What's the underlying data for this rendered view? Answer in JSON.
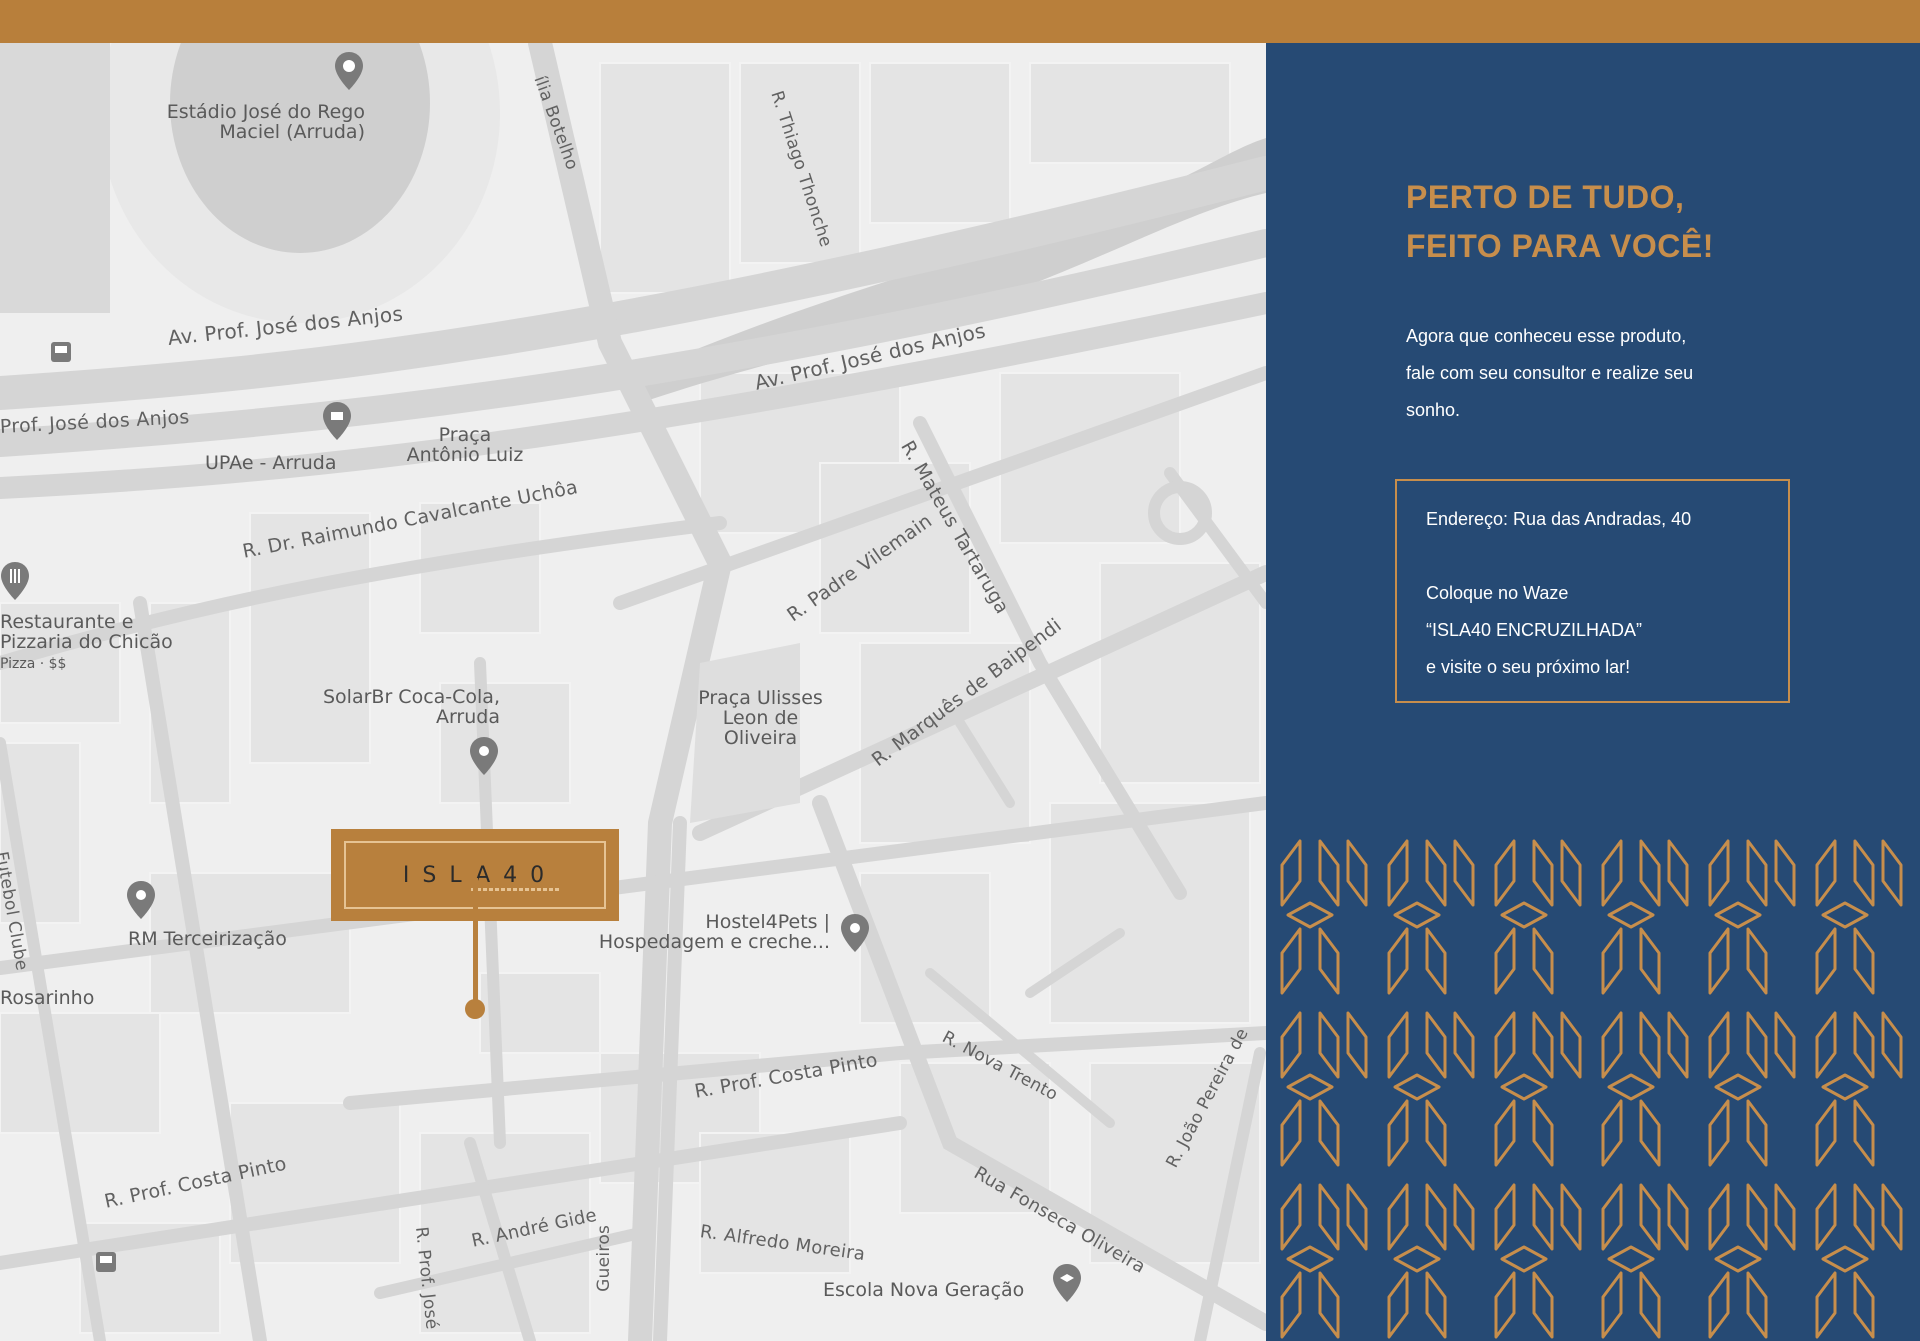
{
  "colors": {
    "accent": "#b87f3b",
    "panel": "#264a74",
    "map_bg": "#efefef",
    "road": "#d6d6d6",
    "block": "#e2e2e2",
    "gold_text": "#c78e4c"
  },
  "map": {
    "streets": [
      "Av. Prof. José dos Anjos",
      "Av. Prof. José dos Anjos",
      "Prof. José dos Anjos",
      "R. Dr. Raimundo Cavalcante Uchôa",
      "R. Padre Vilemain",
      "R. Mateus Tartaruga",
      "R. Marquês de Baipendi",
      "R. Thiago Thonche",
      "ília Botelho",
      "R. Prof. Costa Pinto",
      "R. Prof. Costa Pinto",
      "R. Nova Trento",
      "Rua Fonseca Oliveira",
      "R. João Pereira de",
      "R. André Gide",
      "R. Alfredo Moreira",
      "R. Prof. José",
      "Gueiros",
      "Futebol Clube"
    ],
    "pois": {
      "stadium": "Estádio José do Rego Maciel (Arruda)",
      "upae": "UPAe - Arruda",
      "praca_antonio": "Praça Antônio Luiz",
      "restaurant": "Restaurante e Pizzaria do Chicão",
      "restaurant_sub": "Pizza · $$",
      "solarbr": "SolarBr Coca-Cola, Arruda",
      "praca_ulisses": "Praça Ulisses Leon de Oliveira",
      "rm": "RM Terceirização",
      "rosarinho": "Rosarinho",
      "hostel": "Hostel4Pets | Hospedagem e creche...",
      "escola": "Escola Nova Geração"
    },
    "marker_label": "ISLA40"
  },
  "panel": {
    "headline_1": "PERTO DE TUDO,",
    "headline_2": "FEITO PARA VOCÊ!",
    "intro_1": "Agora que conheceu esse produto,",
    "intro_2": "fale com seu consultor e realize seu",
    "intro_3": "sonho.",
    "address": "Endereço: Rua das Andradas, 40",
    "waze_1": "Coloque no Waze",
    "waze_2": "“ISLA40 ENCRUZILHADA”",
    "waze_3": "e visite o seu próximo lar!"
  }
}
